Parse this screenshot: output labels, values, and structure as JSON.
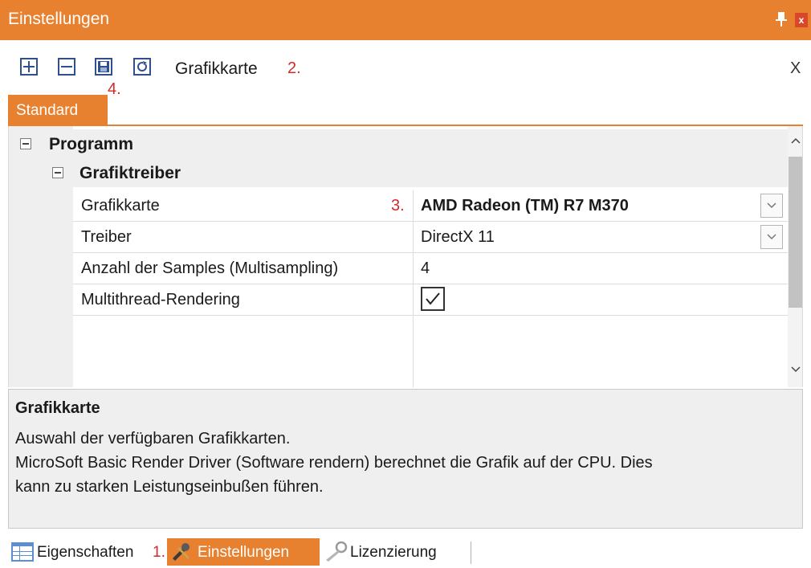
{
  "window": {
    "title": "Einstellungen",
    "pin_icon": "pin-icon",
    "close_label": "x"
  },
  "toolbar": {
    "buttons": [
      {
        "name": "expand-all-button",
        "icon": "plus-box-icon"
      },
      {
        "name": "collapse-all-button",
        "icon": "minus-box-icon"
      },
      {
        "name": "save-button",
        "icon": "floppy-disk-icon"
      },
      {
        "name": "reset-button",
        "icon": "refresh-icon"
      }
    ],
    "title": "Grafikkarte",
    "annotation_2": "2.",
    "annotation_4": "4.",
    "close_label": "X"
  },
  "tabs": {
    "standard": "Standard"
  },
  "grid": {
    "category": "Programm",
    "subcategory": "Grafiktreiber",
    "annotation_3": "3.",
    "rows": [
      {
        "name": "Grafikkarte",
        "value": "AMD Radeon (TM) R7 M370",
        "bold": true,
        "dropdown": true
      },
      {
        "name": "Treiber",
        "value": "DirectX 11",
        "bold": false,
        "dropdown": true
      },
      {
        "name": "Anzahl der Samples (Multisampling)",
        "value": "4",
        "bold": false,
        "dropdown": false
      },
      {
        "name": "Multithread-Rendering",
        "value": "",
        "checkbox": true,
        "checked": true
      }
    ]
  },
  "description": {
    "title": "Grafikkarte",
    "lines": [
      "Auswahl der verfügbaren Grafikkarten.",
      "MicroSoft Basic Render Driver (Software rendern) berechnet die Grafik auf der CPU. Dies",
      "kann zu starken Leistungseinbußen führen."
    ]
  },
  "bottom_tabs": {
    "eigenschaften": "Eigenschaften",
    "annotation_1": "1.",
    "einstellungen": "Einstellungen",
    "lizenzierung": "Lizenzierung"
  },
  "colors": {
    "accent": "#e8812f",
    "annotation": "#d42a2a",
    "panel_gray": "#efefef"
  }
}
